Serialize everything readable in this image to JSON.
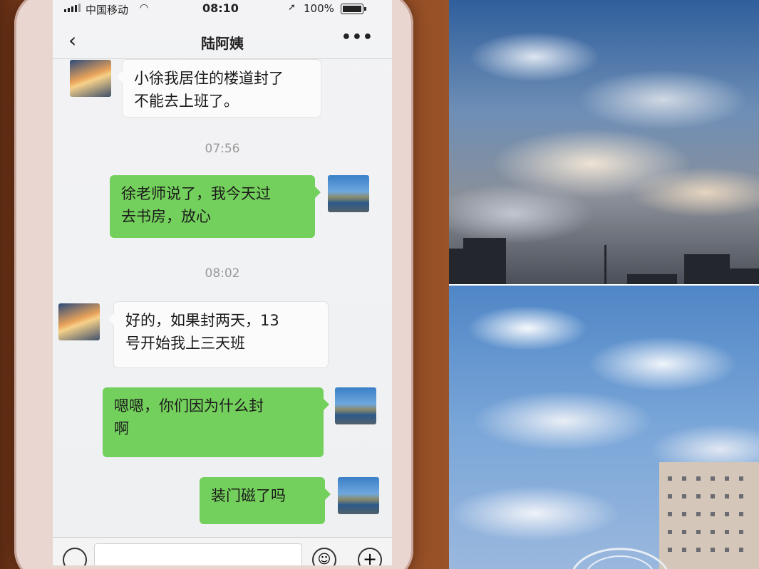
{
  "status_bar": {
    "carrier": "中国移动",
    "time": "08:10",
    "battery": "100%"
  },
  "nav": {
    "title": "陆阿姨"
  },
  "messages": [
    {
      "side": "in",
      "avatar": "sunset-avatar",
      "text_line1": "小徐我居住的楼道封了",
      "text_line2": "不能去上班了。"
    },
    {
      "side": "out",
      "avatar": "river-avatar",
      "text_line1": "徐老师说了，我今天过",
      "text_line2": "去书房，放心"
    },
    {
      "side": "in",
      "avatar": "sunset-avatar",
      "text_line1": "好的，如果封两天，13",
      "text_line2": "号开始我上三天班"
    },
    {
      "side": "out",
      "avatar": "river-avatar",
      "text_line1": "嗯嗯，你们因为什么封",
      "text_line2": "啊"
    },
    {
      "side": "out",
      "avatar": "river-avatar",
      "text_line1": "装门磁了吗",
      "text_line2": ""
    }
  ],
  "timestamps": [
    "07:56",
    "08:02"
  ],
  "colors": {
    "outgoing_bubble": "#74d05c",
    "incoming_bubble": "#fbfbfb",
    "chat_background": "#f3f3f5"
  },
  "icons": [
    "signal-icon",
    "wifi-icon",
    "location-icon",
    "battery-icon",
    "back-chevron-icon",
    "more-dots-icon",
    "voice-icon",
    "emoji-icon",
    "plus-icon"
  ]
}
